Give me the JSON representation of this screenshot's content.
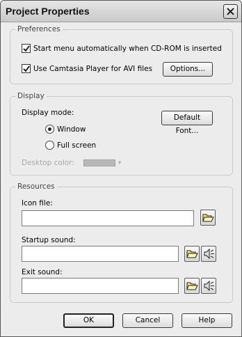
{
  "window": {
    "title": "Project Properties"
  },
  "preferences": {
    "legend": "Preferences",
    "autostart_label": "Start menu automatically when CD-ROM is inserted",
    "autostart_checked": true,
    "camtasia_label": "Use Camtasia Player for AVI files",
    "camtasia_checked": true,
    "options_label": "Options..."
  },
  "display": {
    "legend": "Display",
    "mode_label": "Display mode:",
    "default_font_label": "Default Font...",
    "window_label": "Window",
    "fullscreen_label": "Full screen",
    "selected_mode": "Window",
    "desktop_color_label": "Desktop color:",
    "desktop_color": "#b8b8b8"
  },
  "resources": {
    "legend": "Resources",
    "icon_file_label": "Icon file:",
    "icon_file_value": "",
    "startup_sound_label": "Startup sound:",
    "startup_sound_value": "",
    "exit_sound_label": "Exit sound:",
    "exit_sound_value": ""
  },
  "footer": {
    "ok_label": "OK",
    "cancel_label": "Cancel",
    "help_label": "Help"
  },
  "icons": {
    "close": "close-icon",
    "open_folder": "open-folder-icon",
    "speaker": "speaker-icon"
  }
}
